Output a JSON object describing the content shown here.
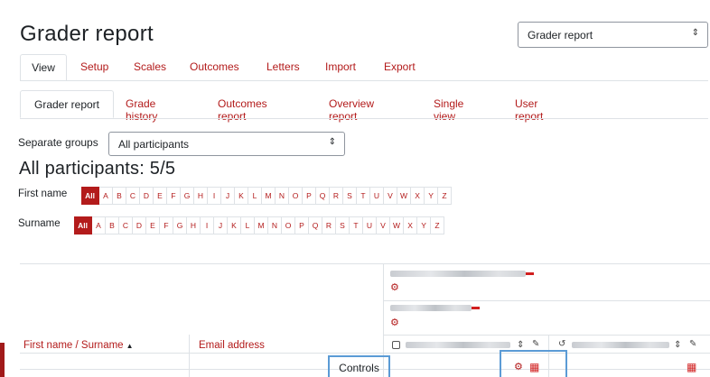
{
  "page": {
    "title": "Grader report",
    "report_select": {
      "value": "Grader report"
    },
    "tabs": [
      {
        "label": "View",
        "active": true
      },
      {
        "label": "Setup"
      },
      {
        "label": "Scales"
      },
      {
        "label": "Outcomes"
      },
      {
        "label": "Letters"
      },
      {
        "label": "Import"
      },
      {
        "label": "Export"
      }
    ],
    "subtabs": [
      {
        "label": "Grader report",
        "active": true
      },
      {
        "label": "Grade history"
      },
      {
        "label": "Outcomes report"
      },
      {
        "label": "Overview report"
      },
      {
        "label": "Single view"
      },
      {
        "label": "User report"
      }
    ]
  },
  "groups": {
    "label": "Separate groups",
    "value": "All participants"
  },
  "participants": {
    "heading": "All participants: 5/5"
  },
  "initials": {
    "first_name_label": "First name",
    "surname_label": "Surname",
    "all_label": "All",
    "letters": [
      "A",
      "B",
      "C",
      "D",
      "E",
      "F",
      "G",
      "H",
      "I",
      "J",
      "K",
      "L",
      "M",
      "N",
      "O",
      "P",
      "Q",
      "R",
      "S",
      "T",
      "U",
      "V",
      "W",
      "X",
      "Y",
      "Z"
    ]
  },
  "grid": {
    "col_name": "First name / Surname",
    "col_email": "Email address",
    "controls_label": "Controls"
  },
  "colors": {
    "accent": "#b31b1b",
    "highlight": "#5b9bd5"
  }
}
